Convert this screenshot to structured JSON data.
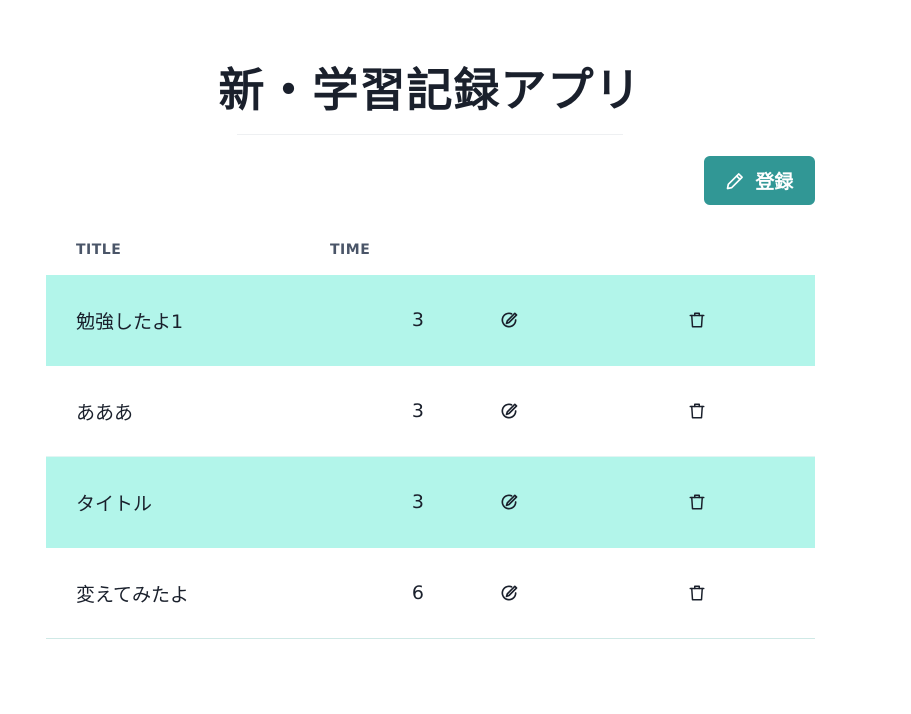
{
  "header": {
    "title": "新・学習記録アプリ"
  },
  "toolbar": {
    "register_label": "登録",
    "register_icon": "pencil-icon"
  },
  "table": {
    "columns": [
      "TITLE",
      "TIME"
    ],
    "rows": [
      {
        "title": "勉強したよ1",
        "time": "3"
      },
      {
        "title": "あああ",
        "time": "3"
      },
      {
        "title": "タイトル",
        "time": "3"
      },
      {
        "title": "変えてみたよ",
        "time": "6"
      }
    ],
    "row_actions": [
      "edit-icon",
      "trash-icon"
    ]
  },
  "colors": {
    "accent": "#319795",
    "striped_row": "#b2f5ea",
    "text": "#1a202c"
  }
}
